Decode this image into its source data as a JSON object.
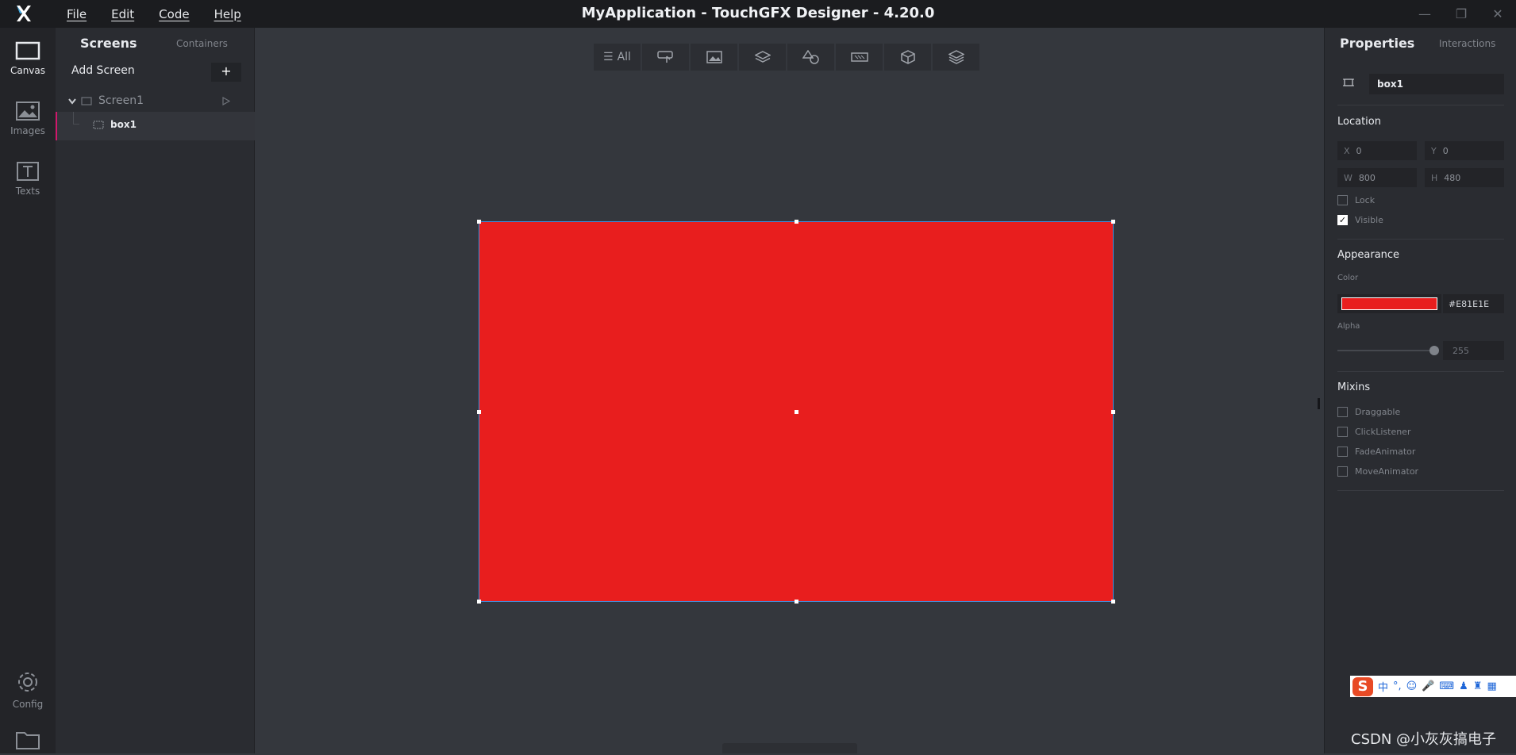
{
  "app": {
    "title": "MyApplication - TouchGFX Designer - 4.20.0",
    "menu": [
      "File",
      "Edit",
      "Code",
      "Help"
    ],
    "window_controls": [
      "minimize",
      "maximize",
      "close"
    ]
  },
  "leftbar": {
    "items": [
      {
        "label": "Canvas",
        "icon": "canvas-icon",
        "active": true
      },
      {
        "label": "Images",
        "icon": "image-icon",
        "active": false
      },
      {
        "label": "Texts",
        "icon": "text-icon",
        "active": false
      },
      {
        "label": "Config",
        "icon": "gear-icon",
        "active": false
      },
      {
        "label": "",
        "icon": "folder-icon",
        "active": false
      }
    ]
  },
  "screens_panel": {
    "tab_screens": "Screens",
    "tab_containers": "Containers",
    "add_screen_label": "Add Screen",
    "add_symbol": "+",
    "tree": [
      {
        "label": "Screen1",
        "type": "screen"
      },
      {
        "label": "box1",
        "type": "box",
        "selected": true
      }
    ]
  },
  "toolbar": {
    "all_label": "All",
    "filters": [
      "all",
      "interaction",
      "image",
      "layers",
      "shapes",
      "keyboard",
      "3d",
      "stack"
    ]
  },
  "canvas": {
    "box_color": "#E81E1E",
    "selection_color": "#3d8fe0"
  },
  "properties": {
    "title": "Properties",
    "interactions_tab": "Interactions",
    "widget_name": "box1",
    "location_title": "Location",
    "x_label": "X",
    "x_value": "0",
    "y_label": "Y",
    "y_value": "0",
    "w_label": "W",
    "w_value": "800",
    "h_label": "H",
    "h_value": "480",
    "lock_label": "Lock",
    "lock_checked": false,
    "visible_label": "Visible",
    "visible_checked": true,
    "appearance_title": "Appearance",
    "color_label": "Color",
    "color_hex": "#E81E1E",
    "alpha_label": "Alpha",
    "alpha_value": "255",
    "mixins_title": "Mixins",
    "mixins": [
      {
        "label": "Draggable",
        "checked": false
      },
      {
        "label": "ClickListener",
        "checked": false
      },
      {
        "label": "FadeAnimator",
        "checked": false
      },
      {
        "label": "MoveAnimator",
        "checked": false
      }
    ]
  },
  "taskbar": {
    "ime_label": "中",
    "ime_brand": "S"
  },
  "watermark": "CSDN @小灰灰搞电子"
}
